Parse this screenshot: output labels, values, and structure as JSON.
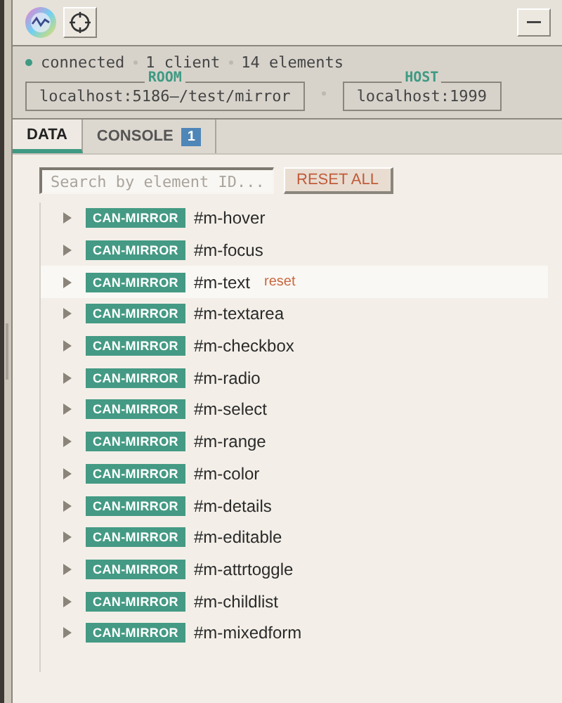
{
  "status": {
    "connected": true,
    "state": "connected",
    "clients": "1 client",
    "elements": "14 elements"
  },
  "room": {
    "label": "ROOM",
    "value": "localhost:5186—/test/mirror"
  },
  "host": {
    "label": "HOST",
    "value": "localhost:1999"
  },
  "tabs": [
    {
      "label": "DATA",
      "selected": true
    },
    {
      "label": "CONSOLE",
      "selected": false,
      "badge": "1"
    }
  ],
  "search": {
    "placeholder": "Search by element ID..."
  },
  "reset_all": "RESET ALL",
  "elements": [
    {
      "tag": "CAN-MIRROR",
      "id": "#m-hover",
      "highlighted": false
    },
    {
      "tag": "CAN-MIRROR",
      "id": "#m-focus",
      "highlighted": false
    },
    {
      "tag": "CAN-MIRROR",
      "id": "#m-text",
      "highlighted": true,
      "reset": "reset"
    },
    {
      "tag": "CAN-MIRROR",
      "id": "#m-textarea",
      "highlighted": false
    },
    {
      "tag": "CAN-MIRROR",
      "id": "#m-checkbox",
      "highlighted": false
    },
    {
      "tag": "CAN-MIRROR",
      "id": "#m-radio",
      "highlighted": false
    },
    {
      "tag": "CAN-MIRROR",
      "id": "#m-select",
      "highlighted": false
    },
    {
      "tag": "CAN-MIRROR",
      "id": "#m-range",
      "highlighted": false
    },
    {
      "tag": "CAN-MIRROR",
      "id": "#m-color",
      "highlighted": false
    },
    {
      "tag": "CAN-MIRROR",
      "id": "#m-details",
      "highlighted": false
    },
    {
      "tag": "CAN-MIRROR",
      "id": "#m-editable",
      "highlighted": false
    },
    {
      "tag": "CAN-MIRROR",
      "id": "#m-attrtoggle",
      "highlighted": false
    },
    {
      "tag": "CAN-MIRROR",
      "id": "#m-childlist",
      "highlighted": false
    },
    {
      "tag": "CAN-MIRROR",
      "id": "#m-mixedform",
      "highlighted": false
    }
  ]
}
